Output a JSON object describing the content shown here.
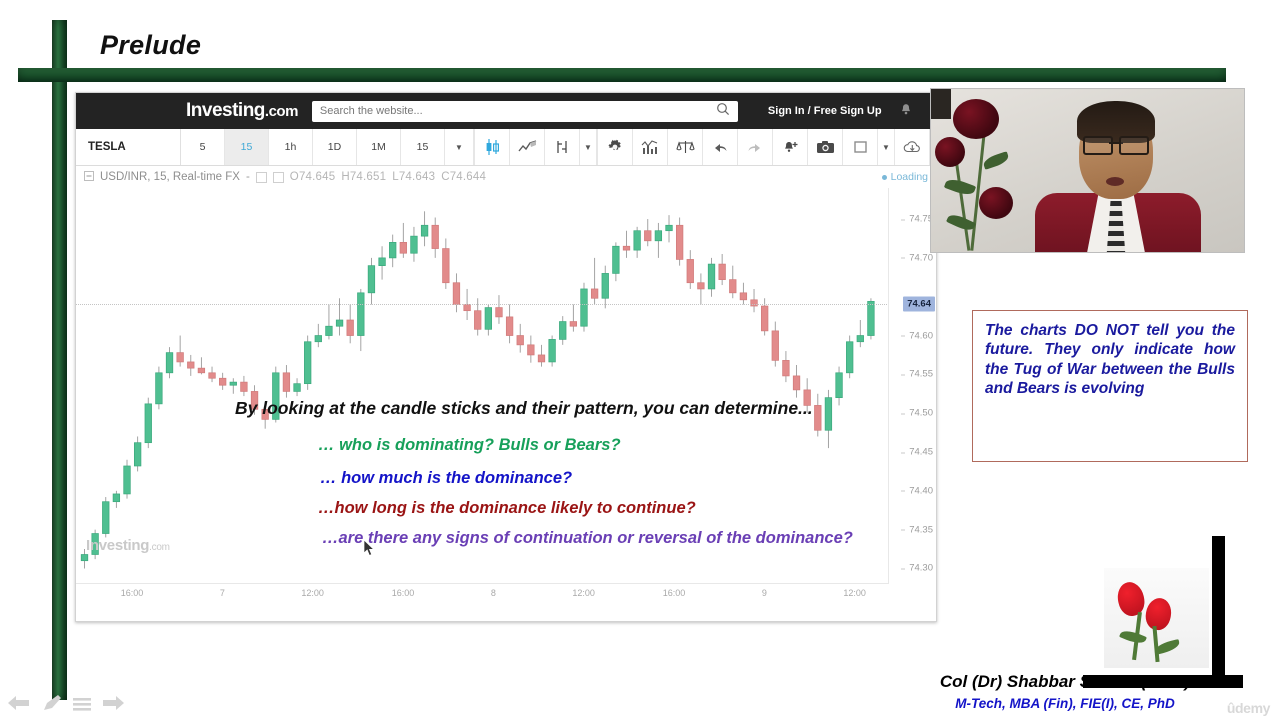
{
  "slide": {
    "title": "Prelude"
  },
  "site": {
    "logo_main": "Investing",
    "logo_suffix": ".com",
    "search_placeholder": "Search the website...",
    "search_value": "",
    "signin_label": "Sign In / Free Sign Up",
    "bell_icon": "bell-icon"
  },
  "toolbar": {
    "symbol": "TESLA",
    "timeframes": [
      "5",
      "15",
      "1h",
      "1D",
      "1M",
      "15"
    ],
    "active_timeframe": "15",
    "caret": "▼",
    "icons": [
      "candlestick-chart-icon",
      "line-chart-icon",
      "bar-style-icon",
      "chart-style-dropdown-icon",
      "gear-icon",
      "indicators-icon",
      "compare-scales-icon",
      "undo-icon",
      "redo-icon",
      "alert-bell-icon",
      "camera-icon",
      "layout-icon",
      "layout-dropdown-icon",
      "cloud-download-icon",
      "cloud-upload-icon"
    ]
  },
  "legend": {
    "symbol": "USD/INR, 15, Real-time FX",
    "open": "O74.645",
    "high": "H74.651",
    "low": "L74.643",
    "close": "C74.644",
    "status": "Loading",
    "watermark_main": "Investing",
    "watermark_suffix": ".com"
  },
  "chart_data": {
    "type": "candlestick",
    "title": "USD/INR, 15, Real-time FX",
    "xlabel": "",
    "ylabel": "",
    "ylim": [
      74.28,
      74.79
    ],
    "grid": false,
    "current_price": "74.64",
    "ohlc": {
      "open": 74.645,
      "high": 74.651,
      "low": 74.643,
      "close": 74.644
    },
    "price_ticks": [
      "74.75",
      "74.70",
      "74.60",
      "74.55",
      "74.50",
      "74.45",
      "74.40",
      "74.35",
      "74.30"
    ],
    "time_ticks": [
      "16:00",
      "7",
      "12:00",
      "16:00",
      "8",
      "12:00",
      "16:00",
      "9",
      "12:00"
    ],
    "up_color": "#4fbf91",
    "down_color": "#e28b8b",
    "candles": [
      {
        "o": 74.31,
        "h": 74.325,
        "l": 74.3,
        "c": 74.318
      },
      {
        "o": 74.318,
        "h": 74.35,
        "l": 74.312,
        "c": 74.345
      },
      {
        "o": 74.345,
        "h": 74.392,
        "l": 74.34,
        "c": 74.386
      },
      {
        "o": 74.386,
        "h": 74.4,
        "l": 74.378,
        "c": 74.396
      },
      {
        "o": 74.396,
        "h": 74.44,
        "l": 74.39,
        "c": 74.432
      },
      {
        "o": 74.432,
        "h": 74.47,
        "l": 74.425,
        "c": 74.462
      },
      {
        "o": 74.462,
        "h": 74.52,
        "l": 74.455,
        "c": 74.512
      },
      {
        "o": 74.512,
        "h": 74.56,
        "l": 74.505,
        "c": 74.552
      },
      {
        "o": 74.552,
        "h": 74.585,
        "l": 74.545,
        "c": 74.578
      },
      {
        "o": 74.578,
        "h": 74.6,
        "l": 74.56,
        "c": 74.566
      },
      {
        "o": 74.566,
        "h": 74.575,
        "l": 74.548,
        "c": 74.558
      },
      {
        "o": 74.558,
        "h": 74.572,
        "l": 74.55,
        "c": 74.552
      },
      {
        "o": 74.552,
        "h": 74.56,
        "l": 74.54,
        "c": 74.545
      },
      {
        "o": 74.545,
        "h": 74.552,
        "l": 74.53,
        "c": 74.536
      },
      {
        "o": 74.536,
        "h": 74.545,
        "l": 74.525,
        "c": 74.54
      },
      {
        "o": 74.54,
        "h": 74.548,
        "l": 74.522,
        "c": 74.528
      },
      {
        "o": 74.528,
        "h": 74.536,
        "l": 74.498,
        "c": 74.505
      },
      {
        "o": 74.505,
        "h": 74.515,
        "l": 74.48,
        "c": 74.492
      },
      {
        "o": 74.492,
        "h": 74.56,
        "l": 74.488,
        "c": 74.552
      },
      {
        "o": 74.552,
        "h": 74.562,
        "l": 74.52,
        "c": 74.528
      },
      {
        "o": 74.528,
        "h": 74.545,
        "l": 74.522,
        "c": 74.538
      },
      {
        "o": 74.538,
        "h": 74.6,
        "l": 74.53,
        "c": 74.592
      },
      {
        "o": 74.592,
        "h": 74.615,
        "l": 74.585,
        "c": 74.6
      },
      {
        "o": 74.6,
        "h": 74.64,
        "l": 74.595,
        "c": 74.612
      },
      {
        "o": 74.612,
        "h": 74.648,
        "l": 74.6,
        "c": 74.62
      },
      {
        "o": 74.62,
        "h": 74.64,
        "l": 74.59,
        "c": 74.6
      },
      {
        "o": 74.6,
        "h": 74.66,
        "l": 74.58,
        "c": 74.655
      },
      {
        "o": 74.655,
        "h": 74.7,
        "l": 74.64,
        "c": 74.69
      },
      {
        "o": 74.69,
        "h": 74.715,
        "l": 74.672,
        "c": 74.7
      },
      {
        "o": 74.7,
        "h": 74.73,
        "l": 74.688,
        "c": 74.72
      },
      {
        "o": 74.72,
        "h": 74.745,
        "l": 74.7,
        "c": 74.706
      },
      {
        "o": 74.706,
        "h": 74.74,
        "l": 74.695,
        "c": 74.728
      },
      {
        "o": 74.728,
        "h": 74.76,
        "l": 74.715,
        "c": 74.742
      },
      {
        "o": 74.742,
        "h": 74.752,
        "l": 74.7,
        "c": 74.712
      },
      {
        "o": 74.712,
        "h": 74.725,
        "l": 74.66,
        "c": 74.668
      },
      {
        "o": 74.668,
        "h": 74.68,
        "l": 74.63,
        "c": 74.64
      },
      {
        "o": 74.64,
        "h": 74.66,
        "l": 74.62,
        "c": 74.632
      },
      {
        "o": 74.632,
        "h": 74.648,
        "l": 74.6,
        "c": 74.608
      },
      {
        "o": 74.608,
        "h": 74.64,
        "l": 74.6,
        "c": 74.636
      },
      {
        "o": 74.636,
        "h": 74.652,
        "l": 74.615,
        "c": 74.624
      },
      {
        "o": 74.624,
        "h": 74.64,
        "l": 74.59,
        "c": 74.6
      },
      {
        "o": 74.6,
        "h": 74.615,
        "l": 74.578,
        "c": 74.588
      },
      {
        "o": 74.588,
        "h": 74.6,
        "l": 74.565,
        "c": 74.575
      },
      {
        "o": 74.575,
        "h": 74.588,
        "l": 74.56,
        "c": 74.566
      },
      {
        "o": 74.566,
        "h": 74.6,
        "l": 74.56,
        "c": 74.595
      },
      {
        "o": 74.595,
        "h": 74.625,
        "l": 74.588,
        "c": 74.618
      },
      {
        "o": 74.618,
        "h": 74.64,
        "l": 74.605,
        "c": 74.612
      },
      {
        "o": 74.612,
        "h": 74.668,
        "l": 74.605,
        "c": 74.66
      },
      {
        "o": 74.66,
        "h": 74.7,
        "l": 74.64,
        "c": 74.648
      },
      {
        "o": 74.648,
        "h": 74.69,
        "l": 74.635,
        "c": 74.68
      },
      {
        "o": 74.68,
        "h": 74.72,
        "l": 74.67,
        "c": 74.715
      },
      {
        "o": 74.715,
        "h": 74.735,
        "l": 74.7,
        "c": 74.71
      },
      {
        "o": 74.71,
        "h": 74.74,
        "l": 74.7,
        "c": 74.735
      },
      {
        "o": 74.735,
        "h": 74.75,
        "l": 74.715,
        "c": 74.722
      },
      {
        "o": 74.722,
        "h": 74.745,
        "l": 74.7,
        "c": 74.735
      },
      {
        "o": 74.735,
        "h": 74.755,
        "l": 74.72,
        "c": 74.742
      },
      {
        "o": 74.742,
        "h": 74.752,
        "l": 74.69,
        "c": 74.698
      },
      {
        "o": 74.698,
        "h": 74.71,
        "l": 74.66,
        "c": 74.668
      },
      {
        "o": 74.668,
        "h": 74.68,
        "l": 74.64,
        "c": 74.66
      },
      {
        "o": 74.66,
        "h": 74.7,
        "l": 74.65,
        "c": 74.692
      },
      {
        "o": 74.692,
        "h": 74.705,
        "l": 74.665,
        "c": 74.672
      },
      {
        "o": 74.672,
        "h": 74.69,
        "l": 74.648,
        "c": 74.655
      },
      {
        "o": 74.655,
        "h": 74.668,
        "l": 74.64,
        "c": 74.646
      },
      {
        "o": 74.646,
        "h": 74.66,
        "l": 74.63,
        "c": 74.638
      },
      {
        "o": 74.638,
        "h": 74.648,
        "l": 74.6,
        "c": 74.606
      },
      {
        "o": 74.606,
        "h": 74.618,
        "l": 74.56,
        "c": 74.568
      },
      {
        "o": 74.568,
        "h": 74.58,
        "l": 74.54,
        "c": 74.548
      },
      {
        "o": 74.548,
        "h": 74.562,
        "l": 74.52,
        "c": 74.53
      },
      {
        "o": 74.53,
        "h": 74.545,
        "l": 74.5,
        "c": 74.51
      },
      {
        "o": 74.51,
        "h": 74.525,
        "l": 74.47,
        "c": 74.478
      },
      {
        "o": 74.478,
        "h": 74.53,
        "l": 74.455,
        "c": 74.52
      },
      {
        "o": 74.52,
        "h": 74.56,
        "l": 74.51,
        "c": 74.552
      },
      {
        "o": 74.552,
        "h": 74.6,
        "l": 74.545,
        "c": 74.592
      },
      {
        "o": 74.592,
        "h": 74.62,
        "l": 74.585,
        "c": 74.6
      },
      {
        "o": 74.6,
        "h": 74.648,
        "l": 74.595,
        "c": 74.644
      }
    ]
  },
  "overlay": {
    "main": "By looking at the candle sticks and their pattern, you can determine...",
    "bullets": [
      "… who is dominating? Bulls or Bears?",
      "… how much is the dominance?",
      "…how long is the dominance likely to continue?",
      "…are there any signs of continuation or reversal of the dominance?"
    ],
    "colors": [
      "#17a05a",
      "#1414c8",
      "#9a1414",
      "#6a3fb5"
    ]
  },
  "quote": {
    "text": "The charts DO NOT tell you the future. They only indicate how the Tug of War between the Bulls and Bears is evolving",
    "border_color": "#b06a5c",
    "text_color": "#1a1a9e"
  },
  "credits": {
    "name": "Col (Dr) Shabbar Shahid (Retd)",
    "degrees": "M-Tech, MBA (Fin), FIE(I),  CE, PhD",
    "watermark": "ûdemy"
  },
  "player": {
    "prev_icon": "arrow-left-icon",
    "pen_icon": "pen-icon",
    "menu_icon": "menu-icon",
    "next_icon": "arrow-right-icon"
  }
}
